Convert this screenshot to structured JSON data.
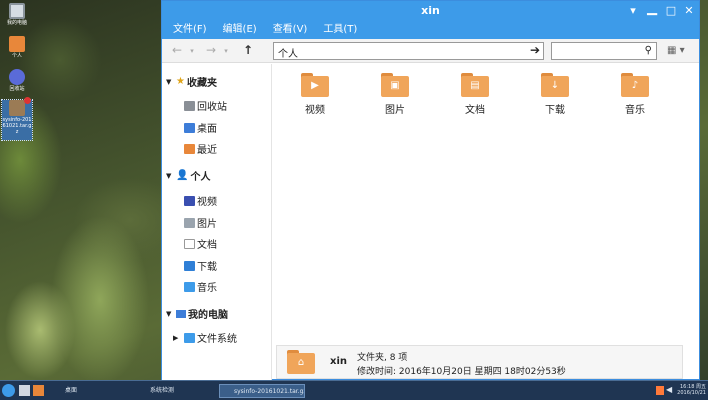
{
  "desktop": {
    "icons": [
      {
        "label": "我的电脑",
        "color": "#d6dde3",
        "icon": "computer-icon"
      },
      {
        "label": "个人",
        "color": "#e8873a",
        "icon": "home-folder-icon"
      },
      {
        "label": "回收站",
        "color": "#5a6bd8",
        "icon": "recycle-bin-icon"
      },
      {
        "label": "sysinfo-20161021.tar.gz",
        "color": "#9b7b55",
        "icon": "archive-icon"
      }
    ]
  },
  "window": {
    "title": "xin",
    "menus": [
      "文件(F)",
      "编辑(E)",
      "查看(V)",
      "工具(T)"
    ],
    "path": "个人",
    "search_placeholder": "",
    "sidebar": {
      "sections": [
        {
          "label": "收藏夹",
          "icon": "star-icon",
          "items": [
            {
              "label": "回收站",
              "icon": "trash-icon"
            },
            {
              "label": "桌面",
              "icon": "desktop-icon"
            },
            {
              "label": "最近",
              "icon": "recent-icon"
            }
          ]
        },
        {
          "label": "个人",
          "icon": "user-icon",
          "items": [
            {
              "label": "视频",
              "icon": "video-icon"
            },
            {
              "label": "图片",
              "icon": "picture-icon"
            },
            {
              "label": "文档",
              "icon": "document-icon"
            },
            {
              "label": "下载",
              "icon": "download-icon"
            },
            {
              "label": "音乐",
              "icon": "music-icon"
            }
          ]
        },
        {
          "label": "我的电脑",
          "icon": "computer-icon",
          "items": [
            {
              "label": "文件系统",
              "icon": "drive-icon"
            }
          ]
        }
      ]
    },
    "files": [
      {
        "label": "视频",
        "glyph": "▶",
        "icon": "video-folder-icon"
      },
      {
        "label": "图片",
        "glyph": "▣",
        "icon": "picture-folder-icon"
      },
      {
        "label": "文档",
        "glyph": "▤",
        "icon": "document-folder-icon"
      },
      {
        "label": "下载",
        "glyph": "↓",
        "icon": "download-folder-icon"
      },
      {
        "label": "音乐",
        "glyph": "♪",
        "icon": "music-folder-icon"
      }
    ],
    "status": {
      "name": "xin",
      "type": "文件夹, 8 项",
      "modified": "修改时间: 2016年10月20日 星期四 18时02分53秒"
    }
  },
  "taskbar": {
    "tasks": [
      "桌面",
      "系统检测",
      "sysinfo-20161021.tar.gz..."
    ],
    "time": "16:18 周五",
    "date": "2016/10/21"
  }
}
